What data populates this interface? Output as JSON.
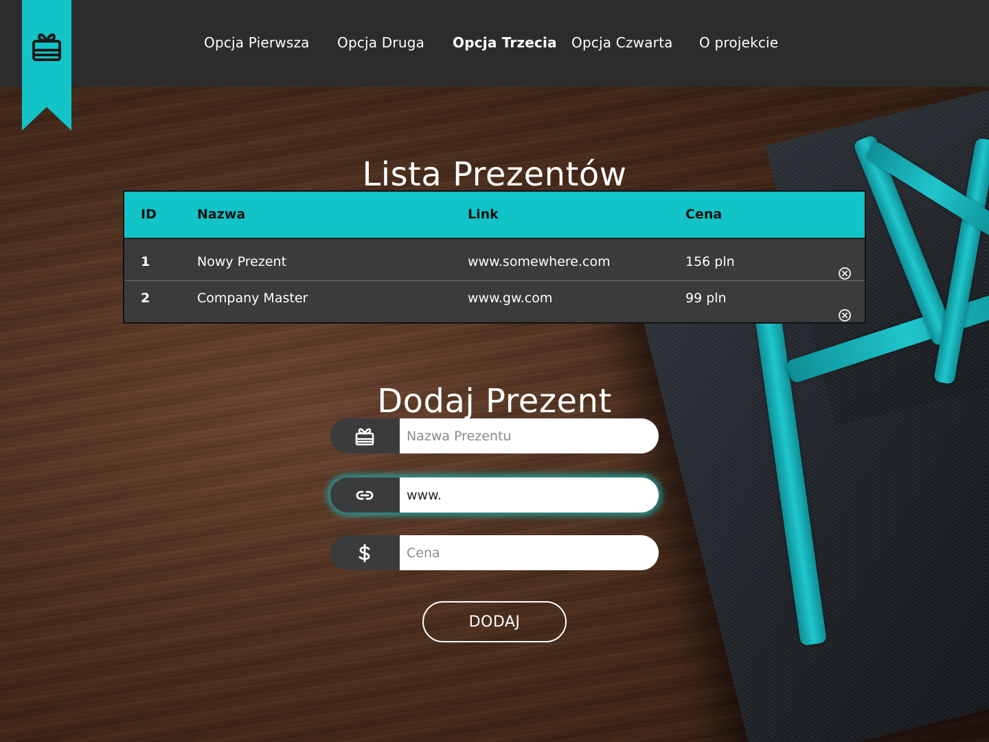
{
  "nav": {
    "items": [
      {
        "label": "Opcja Pierwsza",
        "active": false
      },
      {
        "label": "Opcja Druga",
        "active": false
      },
      {
        "label": "Opcja Trzecia",
        "active": true
      },
      {
        "label": "Opcja Czwarta",
        "active": false
      },
      {
        "label": "O projekcie",
        "active": false
      }
    ]
  },
  "logo": {
    "icon": "gift-icon"
  },
  "list": {
    "title": "Lista Prezentów",
    "columns": [
      "ID",
      "Nazwa",
      "Link",
      "Cena"
    ],
    "rows": [
      {
        "id": "1",
        "name": "Nowy Prezent",
        "link": "www.somewhere.com",
        "price": "156 pln"
      },
      {
        "id": "2",
        "name": "Company Master",
        "link": "www.gw.com",
        "price": "99 pln"
      }
    ],
    "delete_icon": "close-circle-icon"
  },
  "form": {
    "title": "Dodaj Prezent",
    "name_placeholder": "Nazwa Prezentu",
    "name_value": "",
    "link_placeholder": "",
    "link_value": "www.",
    "price_placeholder": "Cena",
    "price_value": "",
    "submit_label": "DODAJ",
    "icons": [
      "gift-icon",
      "link-icon",
      "dollar-icon"
    ]
  },
  "colors": {
    "accent": "#12c3c7",
    "header": "#2b2d2c",
    "table_body": "#3a3b3c"
  }
}
